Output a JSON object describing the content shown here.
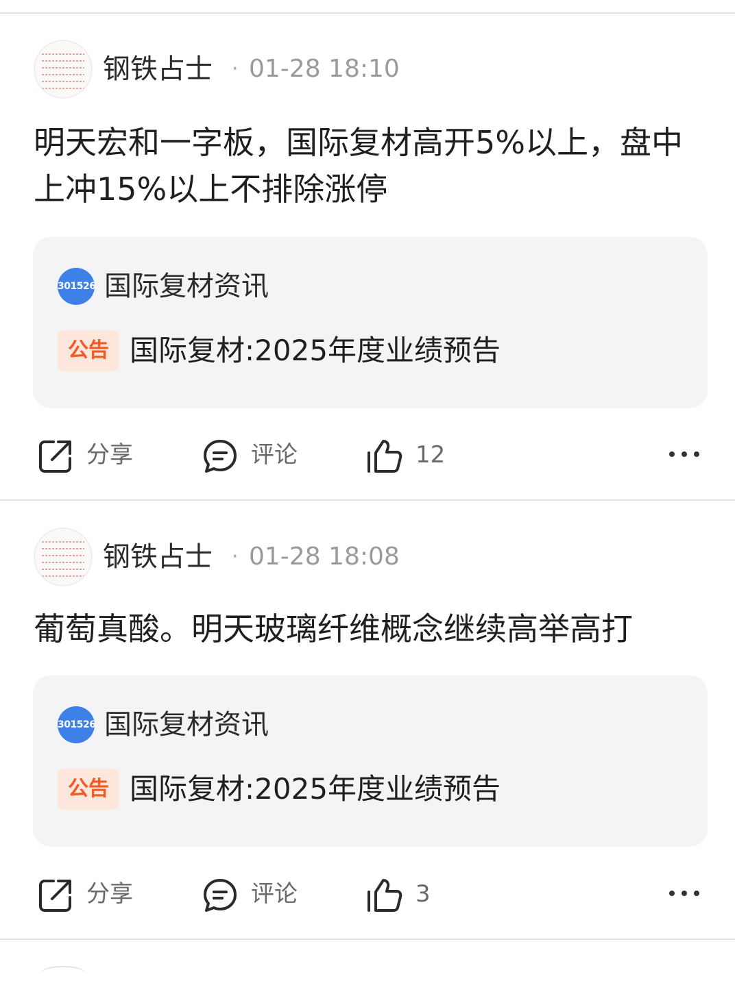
{
  "posts": [
    {
      "author": "钢铁占士",
      "separator": "·",
      "time": "01-28 18:10",
      "text": "明天宏和一字板，国际复材高开5%以上，盘中上冲15%以上不排除涨停",
      "card": {
        "stock_code": "301526",
        "source": "国际复材资讯",
        "tag": "公告",
        "title": "国际复材:2025年度业绩预告"
      },
      "actions": {
        "share": "分享",
        "comment": "评论",
        "likes": "12"
      }
    },
    {
      "author": "钢铁占士",
      "separator": "·",
      "time": "01-28 18:08",
      "text": "葡萄真酸。明天玻璃纤维概念继续高举高打",
      "card": {
        "stock_code": "301526",
        "source": "国际复材资讯",
        "tag": "公告",
        "title": "国际复材:2025年度业绩预告"
      },
      "actions": {
        "share": "分享",
        "comment": "评论",
        "likes": "3"
      }
    }
  ],
  "colors": {
    "stock_badge": "#3d80e6",
    "tag_text": "#f15a24",
    "tag_bg": "#fde6dc",
    "card_bg": "#f4f4f6"
  },
  "icons": {
    "share": "share-icon",
    "comment": "comment-icon",
    "like": "thumbs-up-icon",
    "more": "more-icon"
  }
}
